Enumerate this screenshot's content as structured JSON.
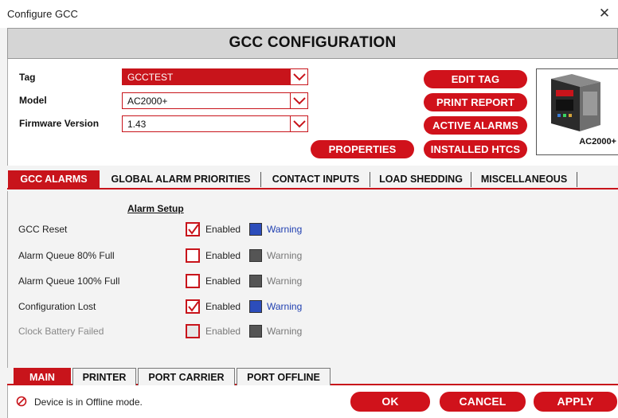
{
  "window": {
    "title": "Configure GCC",
    "close_glyph": "✕"
  },
  "banner": {
    "title": "GCC CONFIGURATION"
  },
  "fields": {
    "tag": {
      "label": "Tag",
      "value": "GCCTEST"
    },
    "model": {
      "label": "Model",
      "value": "AC2000+"
    },
    "firmware": {
      "label": "Firmware Version",
      "value": "1.43"
    }
  },
  "buttons": {
    "edit_tag": "EDIT TAG",
    "print_report": "PRINT REPORT",
    "active_alarms": "ACTIVE ALARMS",
    "installed_htcs": "INSTALLED HTCS",
    "properties": "PROPERTIES"
  },
  "device": {
    "label": "AC2000+"
  },
  "tabs": [
    "GCC ALARMS",
    "GLOBAL ALARM PRIORITIES",
    "CONTACT INPUTS",
    "LOAD SHEDDING",
    "MISCELLANEOUS"
  ],
  "alarm_setup": {
    "heading": "Alarm Setup",
    "enabled_label": "Enabled",
    "warning_label": "Warning",
    "rows": [
      {
        "label": "GCC Reset",
        "enabled": true,
        "available": true
      },
      {
        "label": "Alarm Queue 80% Full",
        "enabled": false,
        "available": true
      },
      {
        "label": "Alarm Queue 100% Full",
        "enabled": false,
        "available": true
      },
      {
        "label": "Configuration Lost",
        "enabled": true,
        "available": true
      },
      {
        "label": "Clock Battery Failed",
        "enabled": false,
        "available": false
      }
    ]
  },
  "bottom_tabs": [
    "MAIN",
    "PRINTER",
    "PORT CARRIER",
    "PORT OFFLINE"
  ],
  "status": {
    "icon": "no-entry-icon",
    "text": "Device is in Offline mode."
  },
  "actions": {
    "ok": "OK",
    "cancel": "CANCEL",
    "apply": "APPLY"
  },
  "colors": {
    "accent": "#c8141b",
    "warning_on": "#2c4dbb",
    "warning_off": "#555555"
  }
}
